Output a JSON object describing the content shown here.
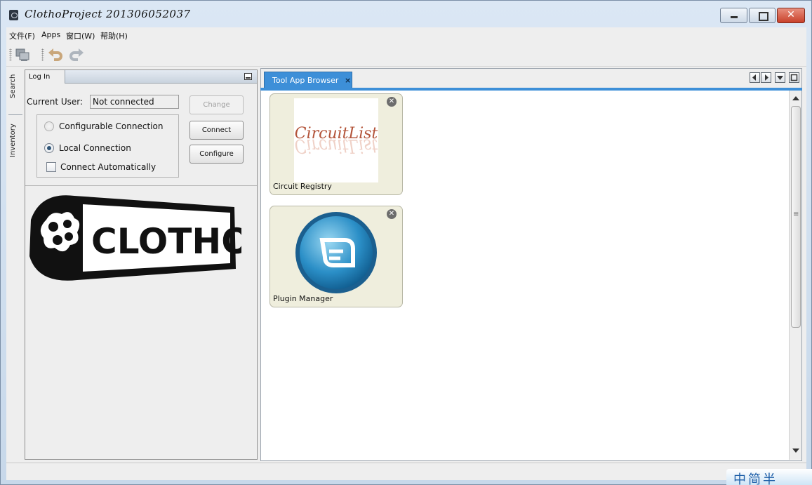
{
  "window": {
    "title": "ClothoProject 201306052037"
  },
  "menu": [
    "文件(F)",
    "Apps",
    "窗口(W)",
    "帮助(H)"
  ],
  "side_tabs": [
    "Search",
    "Inventory"
  ],
  "login": {
    "tab_label": "Log In",
    "current_user_label": "Current User:",
    "current_user_value": "Not connected",
    "options": {
      "configurable": "Configurable Connection",
      "local": "Local Connection",
      "auto": "Connect Automatically"
    },
    "selected_option": "Local Connection",
    "connect_automatically": false,
    "buttons": {
      "change": "Change",
      "connect": "Connect",
      "configure": "Configure"
    },
    "logo_text": "CLOTHO"
  },
  "browser": {
    "tab_label": "Tool App Browser",
    "tab_close": "×",
    "apps": [
      {
        "name": "Circuit Registry",
        "thumb_text": "CircuitList"
      },
      {
        "name": "Plugin Manager"
      }
    ]
  },
  "ime": {
    "text": "中简半"
  },
  "colors": {
    "accent": "#3d8fd8",
    "card_bg": "#efeedd",
    "circuit_text": "#b3543a"
  }
}
